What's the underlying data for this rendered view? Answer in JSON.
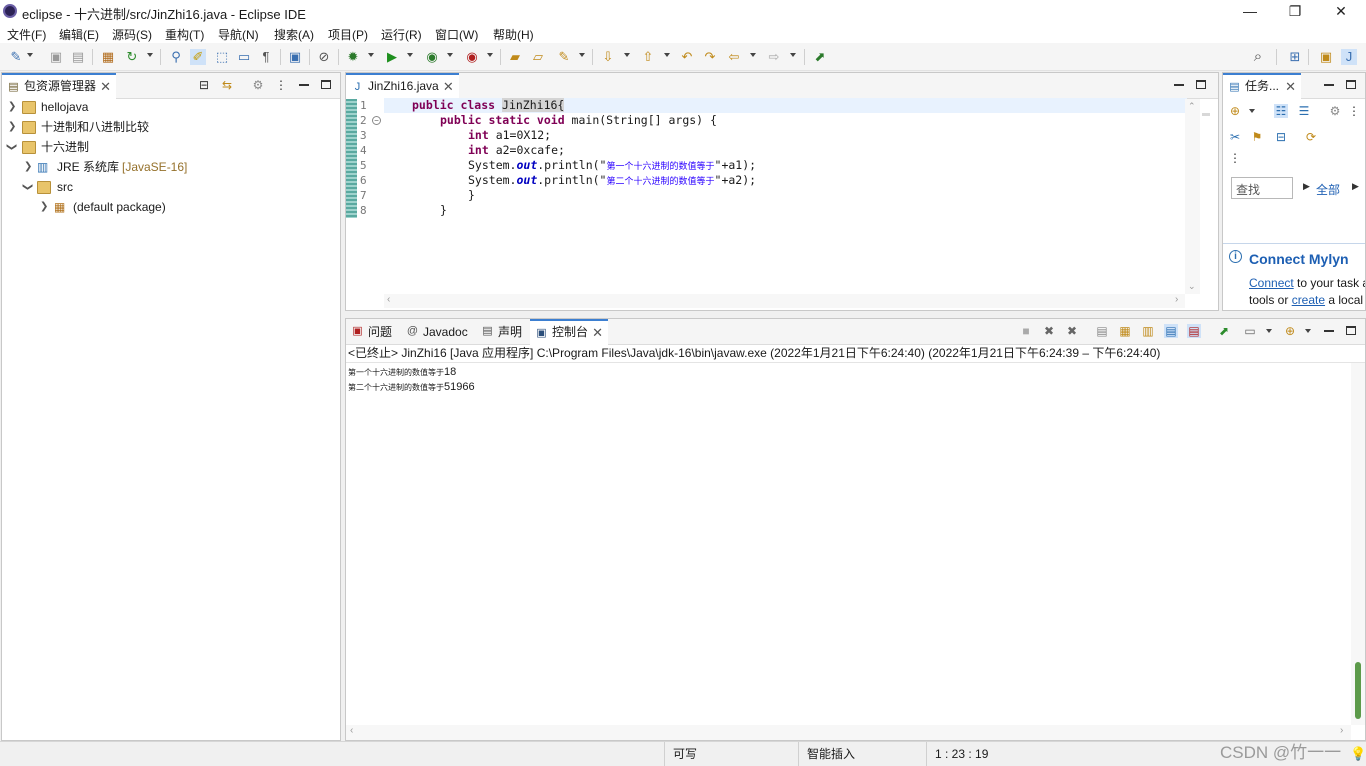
{
  "window": {
    "title": "eclipse - 十六进制/src/JinZhi16.java - Eclipse IDE",
    "minimize_glyph": "—",
    "restore_glyph": "❐",
    "close_glyph": "✕"
  },
  "menu": {
    "file": "文件(F)",
    "edit": "编辑(E)",
    "source": "源码(S)",
    "refactor": "重构(T)",
    "navigate": "导航(N)",
    "search": "搜索(A)",
    "project": "项目(P)",
    "run": "运行(R)",
    "window": "窗口(W)",
    "help": "帮助(H)"
  },
  "package_explorer": {
    "tab_label": "包资源管理器",
    "items": [
      {
        "label": "hellojava",
        "suffix": ""
      },
      {
        "label": "十进制和八进制比较",
        "suffix": ""
      },
      {
        "label": "十六进制",
        "suffix": ""
      },
      {
        "label": "JRE 系统库",
        "suffix": "[JavaSE-16]"
      },
      {
        "label": "src",
        "suffix": ""
      },
      {
        "label": "(default package)",
        "suffix": ""
      }
    ]
  },
  "editor": {
    "tab_label": "JinZhi16.java",
    "line_numbers": [
      "1",
      "2",
      "3",
      "4",
      "5",
      "6",
      "7",
      "8"
    ],
    "code": {
      "l1_kw": "public class",
      "l1_name": "JinZhi16{",
      "l2_kw1": "public static void",
      "l2_rest": " main(String[] args) {",
      "l3_kw": "int",
      "l3_rest": " a1=0X12;",
      "l4_kw": "int",
      "l4_rest": " a2=0xcafe;",
      "l5_pre": "System.",
      "l5_out": "out",
      "l5_mid": ".println(\"",
      "l5_str": "第一个十六进制的数值等于",
      "l5_post": "\"+a1);",
      "l6_pre": "System.",
      "l6_out": "out",
      "l6_mid": ".println(\"",
      "l6_str": "第二个十六进制的数值等于",
      "l6_post": "\"+a2);",
      "l7": "}",
      "l8": "}"
    }
  },
  "tasks_view": {
    "tab_label": "任务...",
    "find_placeholder": "查找",
    "all_label": "全部",
    "connect_title": "Connect Mylyn",
    "connect_link": "Connect",
    "connect_text": " to your task and ALM",
    "tools_text": "tools or ",
    "create_link": "create",
    "create_text": " a local task"
  },
  "bottom_panel": {
    "tabs": {
      "problems": "问题",
      "javadoc": "Javadoc",
      "declaration": "声明",
      "console": "控制台"
    },
    "console_header": "<已终止> JinZhi16 [Java 应用程序] C:\\Program Files\\Java\\jdk-16\\bin\\javaw.exe  (2022年1月21日下午6:24:40)   (2022年1月21日下午6:24:39 – 下午6:24:40)",
    "output": [
      {
        "label": "第一个十六进制的数值等于",
        "value": "18"
      },
      {
        "label": "第二个十六进制的数值等于",
        "value": "51966"
      }
    ]
  },
  "status_bar": {
    "writable": "可写",
    "insert_mode": "智能插入",
    "position": "1 : 23 : 19"
  },
  "watermark": "CSDN @竹一一"
}
